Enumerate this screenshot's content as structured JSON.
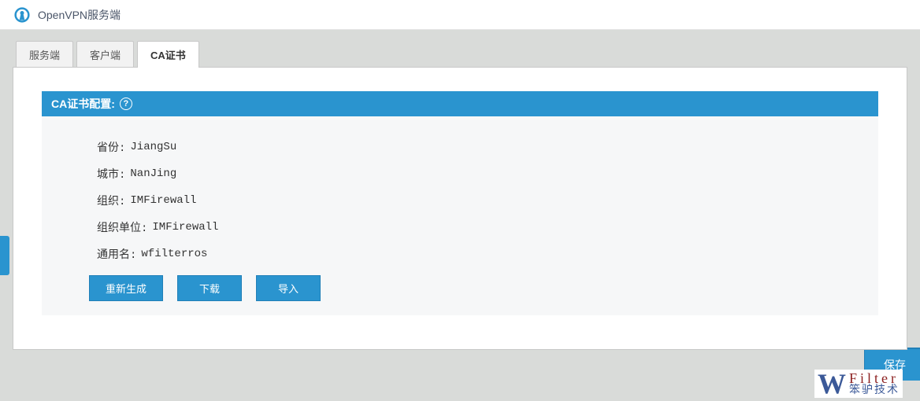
{
  "header": {
    "title": "OpenVPN服务端"
  },
  "tabs": [
    {
      "label": "服务端",
      "active": false
    },
    {
      "label": "客户端",
      "active": false
    },
    {
      "label": "CA证书",
      "active": true
    }
  ],
  "section": {
    "title": "CA证书配置:",
    "help_glyph": "?",
    "fields": {
      "province_label": "省份:",
      "province_value": "JiangSu",
      "city_label": "城市:",
      "city_value": "NanJing",
      "org_label": "组织:",
      "org_value": "IMFirewall",
      "ou_label": "组织单位:",
      "ou_value": "IMFirewall",
      "cn_label": "通用名:",
      "cn_value": "wfilterros"
    },
    "buttons": {
      "regen": "重新生成",
      "download": "下载",
      "import": "导入"
    }
  },
  "footer": {
    "save_label": "保存"
  },
  "brand": {
    "w": "W",
    "main": "Filter",
    "sub": "笨驴技术"
  }
}
